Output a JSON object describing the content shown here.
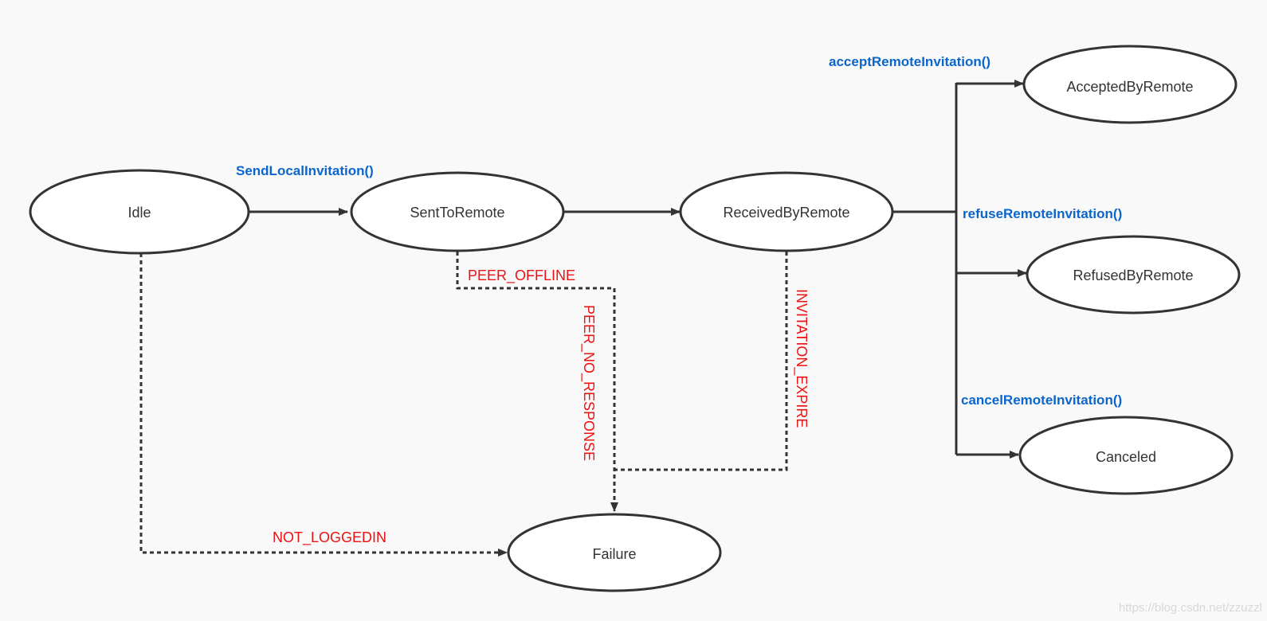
{
  "diagram": {
    "type": "state-machine",
    "colors": {
      "background": "#f9f9f9",
      "node_fill": "#ffffff",
      "edge": "#333333",
      "method_label": "#0b66cc",
      "error_label": "#ee1111",
      "watermark": "#d8d8d8"
    },
    "states": {
      "idle": "Idle",
      "sent": "SentToRemote",
      "received": "ReceivedByRemote",
      "accepted": "AcceptedByRemote",
      "refused": "RefusedByRemote",
      "canceled": "Canceled",
      "failure": "Failure"
    },
    "transitions": {
      "send": "SendLocalInvitation()",
      "accept": "acceptRemoteInvitation()",
      "refuse": "refuseRemoteInvitation()",
      "cancel": "cancelRemoteInvitation()",
      "peer_offline": "PEER_OFFLINE",
      "peer_no_response": "PEER_NO_RESPONSE",
      "invitation_expire": "INVITATION_EXPIRE",
      "not_loggedin": "NOT_LOGGEDIN"
    },
    "edges": [
      {
        "from": "Idle",
        "to": "SentToRemote",
        "label": "SendLocalInvitation()",
        "style": "solid"
      },
      {
        "from": "SentToRemote",
        "to": "ReceivedByRemote",
        "label": "",
        "style": "solid"
      },
      {
        "from": "ReceivedByRemote",
        "to": "AcceptedByRemote",
        "label": "acceptRemoteInvitation()",
        "style": "solid"
      },
      {
        "from": "ReceivedByRemote",
        "to": "RefusedByRemote",
        "label": "refuseRemoteInvitation()",
        "style": "solid"
      },
      {
        "from": "ReceivedByRemote",
        "to": "Canceled",
        "label": "cancelRemoteInvitation()",
        "style": "solid"
      },
      {
        "from": "SentToRemote",
        "to": "Failure",
        "label": "PEER_OFFLINE / PEER_NO_RESPONSE",
        "style": "dashed"
      },
      {
        "from": "ReceivedByRemote",
        "to": "Failure",
        "label": "INVITATION_EXPIRE",
        "style": "dashed"
      },
      {
        "from": "Idle",
        "to": "Failure",
        "label": "NOT_LOGGEDIN",
        "style": "dashed"
      }
    ],
    "watermark": "https://blog.csdn.net/zzuzzl"
  }
}
